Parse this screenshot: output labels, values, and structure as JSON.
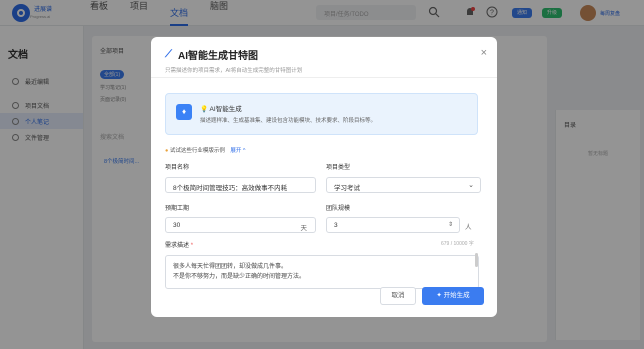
{
  "app": {
    "logo_text": "进展谱",
    "logo_sub": "Progress.ai"
  },
  "nav": {
    "items": [
      "看板",
      "项目",
      "文档",
      "脑图"
    ],
    "active": "文档"
  },
  "search": {
    "placeholder": "项目/任务/TODO"
  },
  "top_pills": [
    "通知",
    "升级"
  ],
  "user": {
    "name": "每周复盘"
  },
  "sidebar": {
    "title": "文档",
    "items": [
      {
        "label": "最近编辑",
        "active": false
      },
      {
        "label": "项目文档",
        "active": false
      },
      {
        "label": "个人笔记",
        "active": true
      },
      {
        "label": "文件管理",
        "active": false
      }
    ]
  },
  "background": {
    "all_projects": "全部项目",
    "filter_all": "全部(1)",
    "filter_study": "学习笔记(1)",
    "filter_recent": "页面记录(0)",
    "search_doc": "搜索文档",
    "tree_item": "8个极简时间...",
    "right_title": "目录",
    "right_empty": "暂无标题"
  },
  "modal": {
    "title": "AI智能生成甘特图",
    "subtitle": "只需描述你的项目需求，AI将自动生成完整的甘特图计划",
    "close": "×",
    "info_title": "AI智能生成",
    "info_desc": "描述题样准、生成基准集、建设包含功能模块、技术要求、阶段目标等。",
    "hint": "试试这些行业模版示例",
    "hint_expand": "展开 ^",
    "project_name_label": "项目名称",
    "project_name_value": "8个极简时间管理技巧：高效做事不内耗",
    "project_type_label": "项目类型",
    "project_type_value": "学习考试",
    "duration_label": "预期工期",
    "duration_value": "30",
    "duration_unit": "天",
    "team_label": "团队规模",
    "team_value": "3",
    "team_unit": "人",
    "req_label": "需求描述",
    "req_star": "*",
    "req_count": "679 / 10000 字",
    "req_text_1": "很多人每天忙得团团转，却没做成几件事。",
    "req_text_2": "不是你不够努力，而是缺少正确的时间管理方法。",
    "cancel": "取消",
    "generate": "开始生成"
  }
}
